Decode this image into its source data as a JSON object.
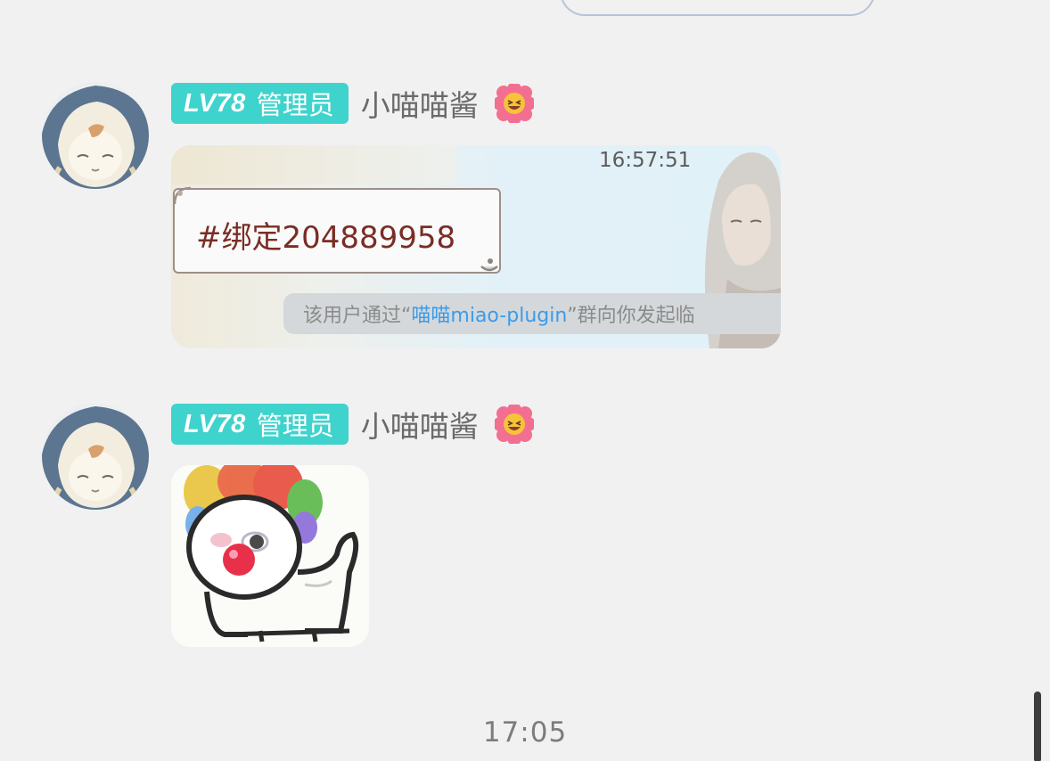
{
  "messages": [
    {
      "badge": {
        "level": "LV78",
        "role": "管理员"
      },
      "sender": "小喵喵酱",
      "emoji": "grinning-flower-emoji",
      "image": {
        "kind": "screenshot",
        "time": "16:57:51",
        "bubble_text": "#绑定204889958",
        "notice_prefix": "该用户通过“",
        "notice_link": "喵喵miao-plugin",
        "notice_suffix": "”群向你发起临"
      }
    },
    {
      "badge": {
        "level": "LV78",
        "role": "管理员"
      },
      "sender": "小喵喵酱",
      "emoji": "grinning-flower-emoji",
      "image": {
        "kind": "sticker",
        "description": "clown-cat-sticker"
      }
    }
  ],
  "timestamp": "17:05",
  "colors": {
    "badge": "#3fd3cd",
    "link": "#3a9cea",
    "background": "#f1f1f1"
  }
}
